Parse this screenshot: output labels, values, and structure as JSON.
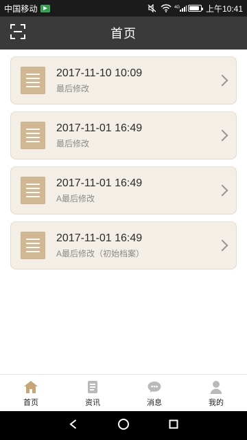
{
  "status_bar": {
    "carrier": "中国移动",
    "time": "上午10:41",
    "battery_level": 0.8,
    "icons": [
      "app-badge-icon",
      "mute-icon",
      "wifi-icon",
      "4g-signal-icon",
      "battery-icon"
    ]
  },
  "header": {
    "title": "首页",
    "left_icon": "scan-icon"
  },
  "records": [
    {
      "datetime": "2017-11-10 10:09",
      "label": "最后修改"
    },
    {
      "datetime": "2017-11-01 16:49",
      "label": "最后修改"
    },
    {
      "datetime": "2017-11-01 16:49",
      "label": "A最后修改"
    },
    {
      "datetime": "2017-11-01 16:49",
      "label": "A最后修改（初始档案）"
    }
  ],
  "tabs": [
    {
      "label": "首页",
      "icon": "home-icon",
      "active": true
    },
    {
      "label": "资讯",
      "icon": "news-icon",
      "active": false
    },
    {
      "label": "消息",
      "icon": "message-icon",
      "active": false
    },
    {
      "label": "我的",
      "icon": "profile-icon",
      "active": false
    }
  ],
  "colors": {
    "status_bar_bg": "#1b1b1b",
    "top_bar_bg": "#3a3a3a",
    "card_bg": "#f4efe6",
    "card_border": "#e6dccd",
    "doc_icon": "#d2b892",
    "tab_active": "#c6a676",
    "tab_inactive": "#b9b9b9"
  }
}
